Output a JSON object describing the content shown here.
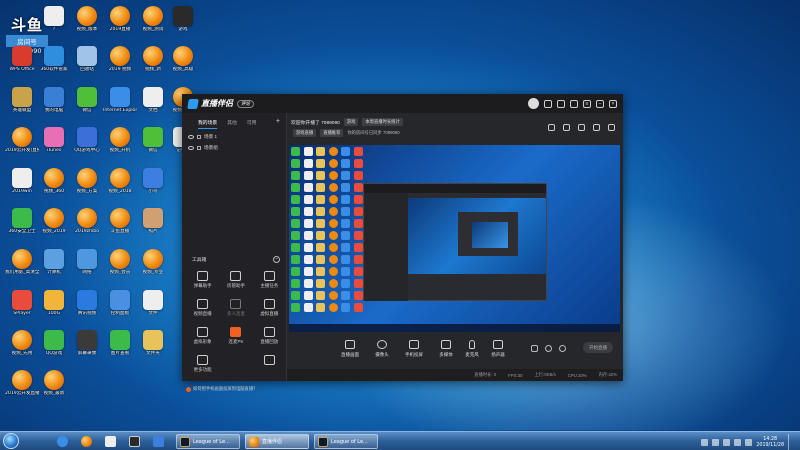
{
  "stream_badge": {
    "logo": "斗鱼",
    "label": "房间号",
    "room_id": "7089090"
  },
  "desktop_icons": [
    {
      "label": "Administr...",
      "color": "#e7c06a"
    },
    {
      "label": "WPS Office",
      "color": "#d93b2f"
    },
    {
      "label": "英雄联盟",
      "color": "#caa24a"
    },
    {
      "label": "2019云开发(直播版)",
      "color": "#f08a0e"
    },
    {
      "label": "2019win",
      "color": "#eeeeee"
    },
    {
      "label": "360安全卫士",
      "color": "#3dbb4a"
    },
    {
      "label": "我们用影_高清全局",
      "color": "#f08a0e"
    },
    {
      "label": "SPlayer",
      "color": "#e94b3c"
    },
    {
      "label": "视频_先用",
      "color": "#f08a0e"
    },
    {
      "label": "2019云开发直播",
      "color": "#f08a0e"
    },
    {
      "label": "?",
      "color": "#eeeeee"
    },
    {
      "label": "360软件管家",
      "color": "#2f8fdf"
    },
    {
      "label": "我的电脑",
      "color": "#3a7fd6"
    },
    {
      "label": "iTunes",
      "color": "#e96fb5"
    },
    {
      "label": "视频_360",
      "color": "#f08a0e"
    },
    {
      "label": "视频_2019",
      "color": "#f08a0e"
    },
    {
      "label": "计算机",
      "color": "#5da0e2"
    },
    {
      "label": "100G",
      "color": "#f0b53a"
    },
    {
      "label": "QQ游戏",
      "color": "#3dbb4a"
    },
    {
      "label": "视频_最新",
      "color": "#f08a0e"
    },
    {
      "label": "视频_版本",
      "color": "#f08a0e"
    },
    {
      "label": "回收站",
      "color": "#9fc4e8"
    },
    {
      "label": "微信",
      "color": "#4fbf3a"
    },
    {
      "label": "QQ游戏中心",
      "color": "#3c6fd8"
    },
    {
      "label": "视频_方案",
      "color": "#f08a0e"
    },
    {
      "label": "2019zhibo",
      "color": "#f08a0e"
    },
    {
      "label": "网络",
      "color": "#4f98df"
    },
    {
      "label": "腾讯视频",
      "color": "#2b7ae0"
    },
    {
      "label": "屏幕录像",
      "color": "#3a3a3a"
    },
    {
      "label": "2019直播",
      "color": "#f08a0e"
    },
    {
      "label": "2019 视频",
      "color": "#f08a0e"
    },
    {
      "label": "Internet Explorer",
      "color": "#3b8ee8"
    },
    {
      "label": "视频_开机",
      "color": "#f08a0e"
    },
    {
      "label": "视频_2018",
      "color": "#f08a0e"
    },
    {
      "label": "斗鱼直播",
      "color": "#f08a0e"
    },
    {
      "label": "视频_会员",
      "color": "#f08a0e"
    },
    {
      "label": "控制面板",
      "color": "#4a90e2"
    },
    {
      "label": "图片查看",
      "color": "#3dbb4a"
    },
    {
      "label": "视频_测试",
      "color": "#f08a0e"
    },
    {
      "label": "视频_新",
      "color": "#f08a0e"
    },
    {
      "label": "文档",
      "color": "#eeeeee"
    },
    {
      "label": "微信",
      "color": "#4fbf3a"
    },
    {
      "label": "小鸟",
      "color": "#3c7fe0"
    },
    {
      "label": "照片",
      "color": "#d0a070"
    },
    {
      "label": "视频_专业",
      "color": "#f08a0e"
    },
    {
      "label": "文件",
      "color": "#eeeeee"
    },
    {
      "label": "文件夹",
      "color": "#e8c25a"
    },
    {
      "label": "游戏",
      "color": "#2a2a2a"
    },
    {
      "label": "视频_高级",
      "color": "#f08a0e"
    },
    {
      "label": "视频_播放",
      "color": "#f08a0e"
    },
    {
      "label": "记事本",
      "color": "#eeeeee"
    }
  ],
  "app": {
    "name": "直播伴侣",
    "version": "评论",
    "sidebar_tabs": [
      "我的场景",
      "其他",
      "可用"
    ],
    "scenes": [
      "场景 1",
      "场景组"
    ],
    "tools_title": "工具箱",
    "tools": [
      {
        "label": "弹幕助手",
        "style": "normal"
      },
      {
        "label": "房管助手",
        "style": "normal"
      },
      {
        "label": "主播任务",
        "style": "normal"
      },
      {
        "label": "视频直播",
        "style": "normal"
      },
      {
        "label": "多人连麦",
        "style": "dim"
      },
      {
        "label": "虚拟直播",
        "style": "normal"
      },
      {
        "label": "虚拟形象",
        "style": "normal"
      },
      {
        "label": "连麦PK",
        "style": "hot"
      },
      {
        "label": "直播回放",
        "style": "normal"
      },
      {
        "label": "更多功能",
        "style": "normal"
      },
      {
        "label": "",
        "style": "none"
      },
      {
        "label": "",
        "style": "normal"
      }
    ],
    "tip": "如何把手机画面投屏到电脑直播？",
    "welcome": "欢迎你开播了 7089090",
    "welcome_tag": "游戏",
    "info_tag": "本周直播时长统计",
    "info_row2_a": "游戏直播",
    "info_row2_b": "直播推荐",
    "info_row2_text": "你的房间号已同步 7089090",
    "controls": [
      {
        "label": "直播画面"
      },
      {
        "label": "摄像头"
      },
      {
        "label": "手机投屏"
      },
      {
        "label": "多媒体"
      },
      {
        "label": "麦克风"
      },
      {
        "label": "扬声器"
      }
    ],
    "start_button": "开始直播",
    "status": [
      "直播时长: 0",
      "FPS:30",
      "上行:0KB/s",
      "CPU:10%",
      "内存:42%"
    ]
  },
  "taskbar": {
    "tasks": [
      "League of Le...",
      "直播伴侣",
      "League of Le..."
    ],
    "time": "14:28",
    "date": "2019/11/28"
  }
}
